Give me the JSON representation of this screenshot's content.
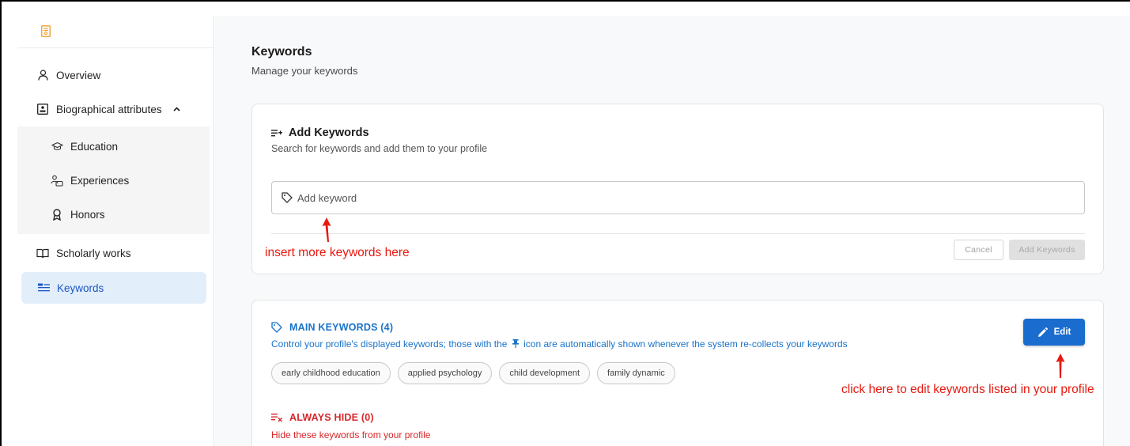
{
  "sidebar": {
    "items": [
      {
        "label": "Overview",
        "icon": "user-icon"
      },
      {
        "label": "Biographical attributes",
        "icon": "id-card-icon"
      },
      {
        "label": "Education",
        "icon": "graduation-cap-icon"
      },
      {
        "label": "Experiences",
        "icon": "people-icon"
      },
      {
        "label": "Honors",
        "icon": "award-icon"
      },
      {
        "label": "Scholarly works",
        "icon": "book-icon"
      },
      {
        "label": "Keywords",
        "icon": "list-icon"
      }
    ],
    "active": "Keywords"
  },
  "header": {
    "title": "Keywords",
    "subtitle": "Manage your keywords"
  },
  "add_card": {
    "title": "Add Keywords",
    "description": "Search for keywords and add them to your profile",
    "input_placeholder": "Add keyword",
    "cancel_label": "Cancel",
    "add_label": "Add Keywords"
  },
  "main_keywords": {
    "title": "MAIN KEYWORDS (4)",
    "description_before": "Control your profile's displayed keywords; those with the",
    "description_after": "icon are automatically shown whenever the system re-collects your keywords",
    "keywords": [
      "early childhood education",
      "applied psychology",
      "child development",
      "family dynamic"
    ],
    "edit_label": "Edit"
  },
  "always_hide": {
    "title": "ALWAYS HIDE (0)",
    "description": "Hide these keywords from your profile"
  },
  "annotations": {
    "insert_note": "insert more keywords here",
    "edit_note": "click here to edit keywords listed in your profile"
  },
  "colors": {
    "accent_blue": "#1a73c9",
    "button_blue": "#1b6ccf",
    "danger_red": "#d7262a",
    "annotation_red": "#e8190f",
    "logo_orange": "#f0a23a",
    "active_bg": "#e3eefb"
  }
}
